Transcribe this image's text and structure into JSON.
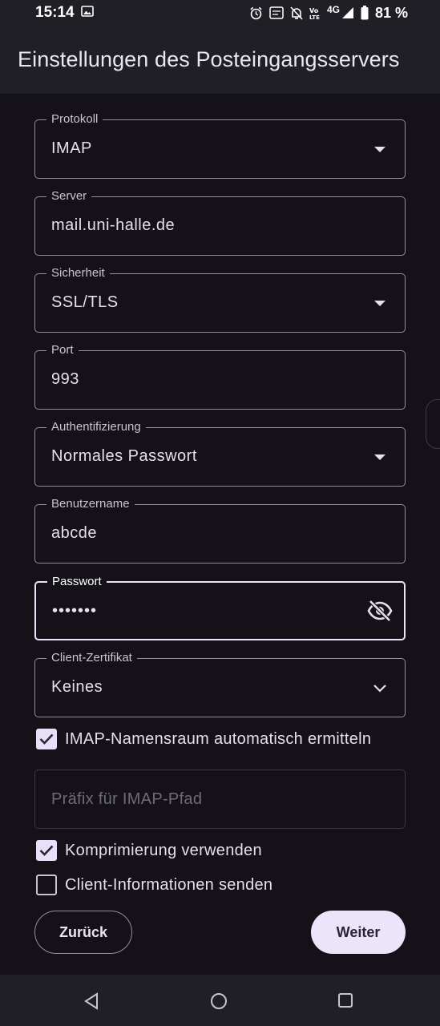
{
  "status_bar": {
    "time": "15:14",
    "battery_pct": "81 %",
    "network": "4G",
    "icons": [
      "image-icon",
      "alarm-icon",
      "data-saver-icon",
      "dnd-icon",
      "volte-icon",
      "signal-icon",
      "battery-icon"
    ]
  },
  "app_bar": {
    "title": "Einstellungen des Posteingangsservers"
  },
  "fields": {
    "protocol": {
      "label": "Protokoll",
      "value": "IMAP"
    },
    "server": {
      "label": "Server",
      "value": "mail.uni-halle.de"
    },
    "security": {
      "label": "Sicherheit",
      "value": "SSL/TLS"
    },
    "port": {
      "label": "Port",
      "value": "993"
    },
    "auth": {
      "label": "Authentifizierung",
      "value": "Normales Passwort"
    },
    "username": {
      "label": "Benutzername",
      "value": "abcde"
    },
    "password": {
      "label": "Passwort",
      "value": "•••••••"
    },
    "client_cert": {
      "label": "Client-Zertifikat",
      "value": "Keines"
    },
    "imap_prefix": {
      "placeholder": "Präfix für IMAP-Pfad"
    }
  },
  "checkboxes": {
    "auto_namespace": {
      "label": "IMAP-Namensraum automatisch ermitteln",
      "checked": true
    },
    "compression": {
      "label": "Komprimierung verwenden",
      "checked": true
    },
    "client_info": {
      "label": "Client-Informationen senden",
      "checked": false
    }
  },
  "buttons": {
    "back": "Zurück",
    "next": "Weiter"
  },
  "colors": {
    "background": "#141218",
    "surface": "#211f26",
    "primary_container": "#ece4fb",
    "outline": "#938f99"
  }
}
